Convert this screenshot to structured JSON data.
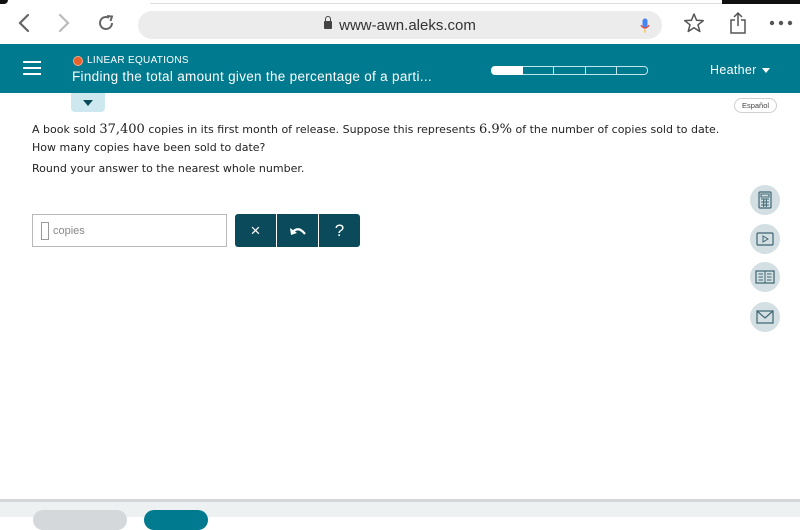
{
  "browser": {
    "url": "www-awn.aleks.com",
    "icons": {
      "back": "chevron-left-icon",
      "forward": "chevron-right-icon",
      "reload": "reload-icon",
      "lock": "lock-icon",
      "mic": "microphone-icon",
      "bookmark": "star-icon",
      "share": "share-icon",
      "more": "more-icon"
    }
  },
  "header": {
    "topic": "LINEAR EQUATIONS",
    "lesson_title": "Finding the total amount given the percentage of a parti...",
    "progress": {
      "segments": 5,
      "filled": 1
    },
    "user_name": "Heather",
    "accent_color": "#007a8f",
    "topic_dot_color": "#e8622c"
  },
  "language_button": "Español",
  "problem": {
    "line1_a": "A book sold ",
    "copies_number": "37,400",
    "line1_b": " copies in its first month of release. Suppose this represents ",
    "percent": "6.9%",
    "line1_c": " of the number of copies sold to date.",
    "line2": "How many copies have been sold to date?",
    "instruction": "Round your answer to the nearest whole number."
  },
  "answer": {
    "value": "",
    "unit": "copies"
  },
  "tools": {
    "clear": "×",
    "undo": "undo-icon",
    "help": "?"
  },
  "side_tools": [
    {
      "name": "calculator",
      "icon": "calculator-icon"
    },
    {
      "name": "video",
      "icon": "video-icon"
    },
    {
      "name": "ebook",
      "icon": "book-icon"
    },
    {
      "name": "message",
      "icon": "mail-icon"
    }
  ]
}
